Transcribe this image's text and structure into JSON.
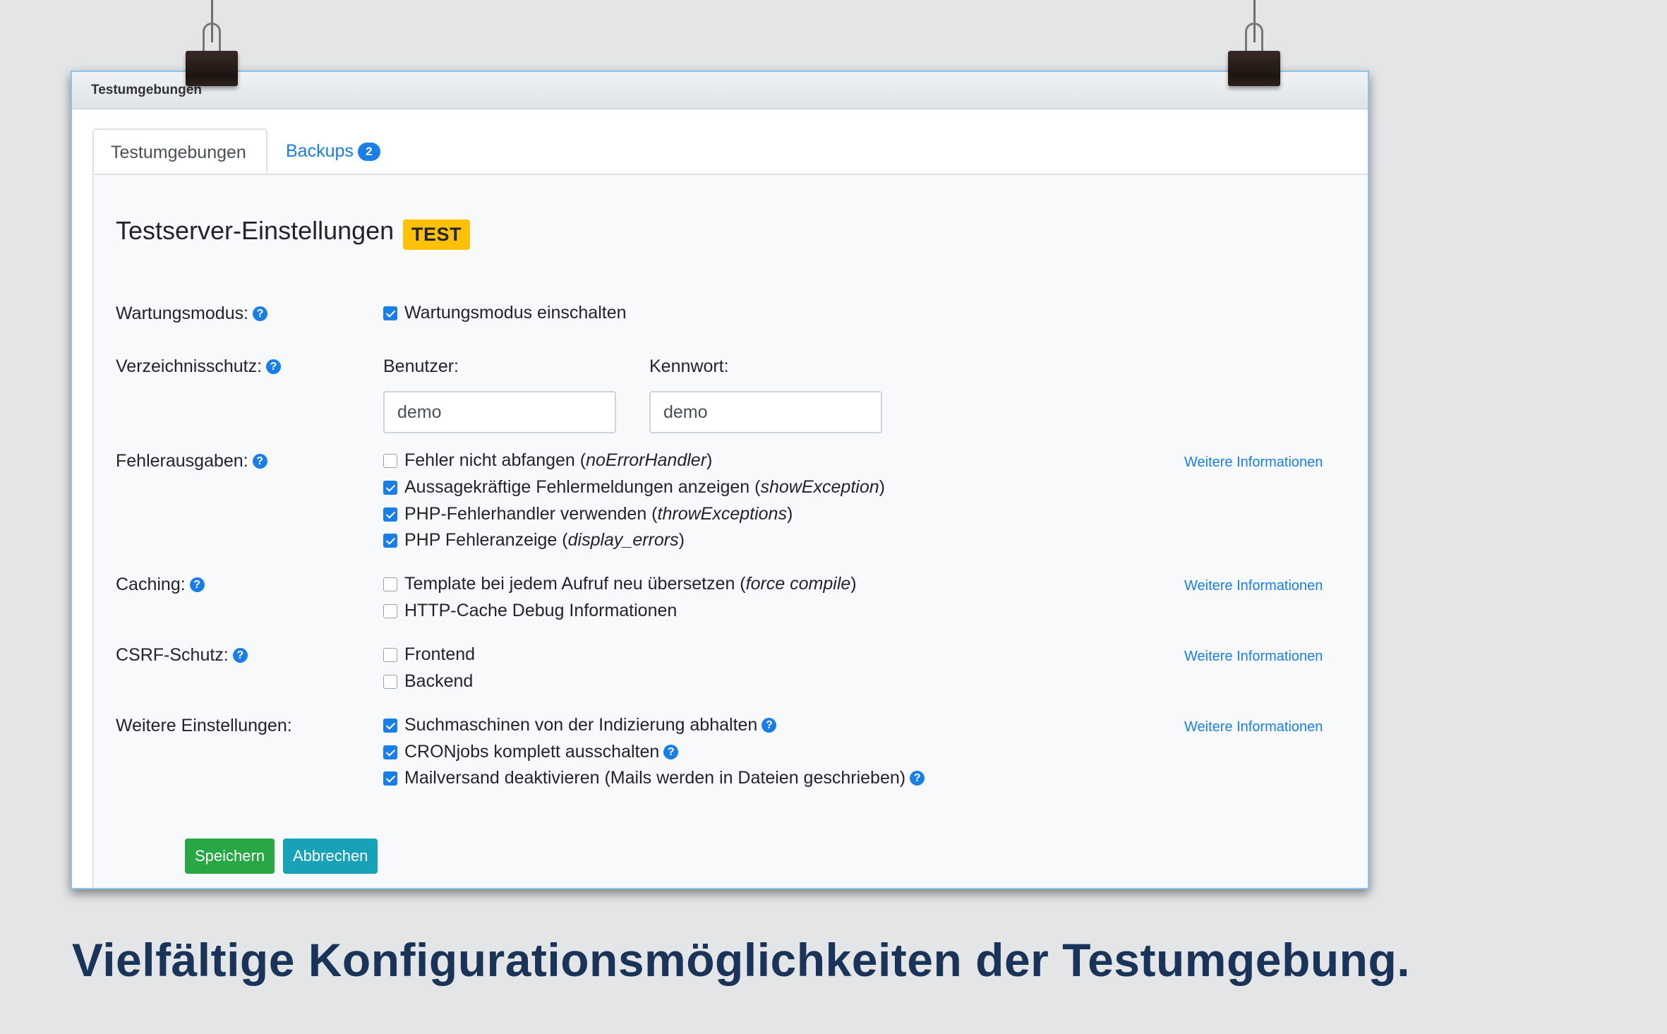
{
  "window": {
    "title": "Testumgebungen"
  },
  "tabs": [
    {
      "label": "Testumgebungen",
      "active": true
    },
    {
      "label": "Backups",
      "badge": "2",
      "active": false
    }
  ],
  "heading": {
    "text": "Testserver-Einstellungen",
    "badge": "TEST"
  },
  "sections": {
    "wartung": {
      "label": "Wartungsmodus:",
      "options": [
        {
          "label": "Wartungsmodus einschalten",
          "checked": true
        }
      ]
    },
    "verzeichnis": {
      "label": "Verzeichnisschutz:",
      "user_label": "Benutzer:",
      "user_value": "demo",
      "pass_label": "Kennwort:",
      "pass_value": "demo"
    },
    "fehler": {
      "label": "Fehlerausgaben:",
      "more": "Weitere Informationen",
      "options": [
        {
          "label": "Fehler nicht abfangen (",
          "code": "noErrorHandler",
          "end": ")",
          "checked": false
        },
        {
          "label": "Aussagekräftige Fehlermeldungen anzeigen (",
          "code": "showException",
          "end": ")",
          "checked": true
        },
        {
          "label": "PHP-Fehlerhandler verwenden (",
          "code": "throwExceptions",
          "end": ")",
          "checked": true
        },
        {
          "label": "PHP Fehleranzeige (",
          "code": "display_errors",
          "end": ")",
          "checked": true
        }
      ]
    },
    "caching": {
      "label": "Caching:",
      "more": "Weitere Informationen",
      "options": [
        {
          "label": "Template bei jedem Aufruf neu übersetzen (",
          "code": "force compile",
          "end": ")",
          "checked": false
        },
        {
          "label": "HTTP-Cache Debug Informationen",
          "checked": false
        }
      ]
    },
    "csrf": {
      "label": "CSRF-Schutz:",
      "more": "Weitere Informationen",
      "options": [
        {
          "label": "Frontend",
          "checked": false
        },
        {
          "label": "Backend",
          "checked": false
        }
      ]
    },
    "weitere": {
      "label": "Weitere Einstellungen:",
      "more": "Weitere Informationen",
      "options": [
        {
          "label": "Suchmaschinen von der Indizierung abhalten",
          "checked": true
        },
        {
          "label": "CRONjobs komplett ausschalten",
          "checked": true
        },
        {
          "label": "Mailversand deaktivieren (Mails werden in Dateien geschrieben)",
          "checked": true
        }
      ]
    }
  },
  "buttons": {
    "save": "Speichern",
    "cancel": "Abbrechen"
  },
  "caption": "Vielfältige Konfigurationsmöglichkeiten der Testumgebung.",
  "help_glyph": "?",
  "colors": {
    "accent": "#1a7ee8",
    "save": "#28a745",
    "cancel": "#17a2b8",
    "badge": "#ffc107",
    "caption": "#1a3358"
  }
}
